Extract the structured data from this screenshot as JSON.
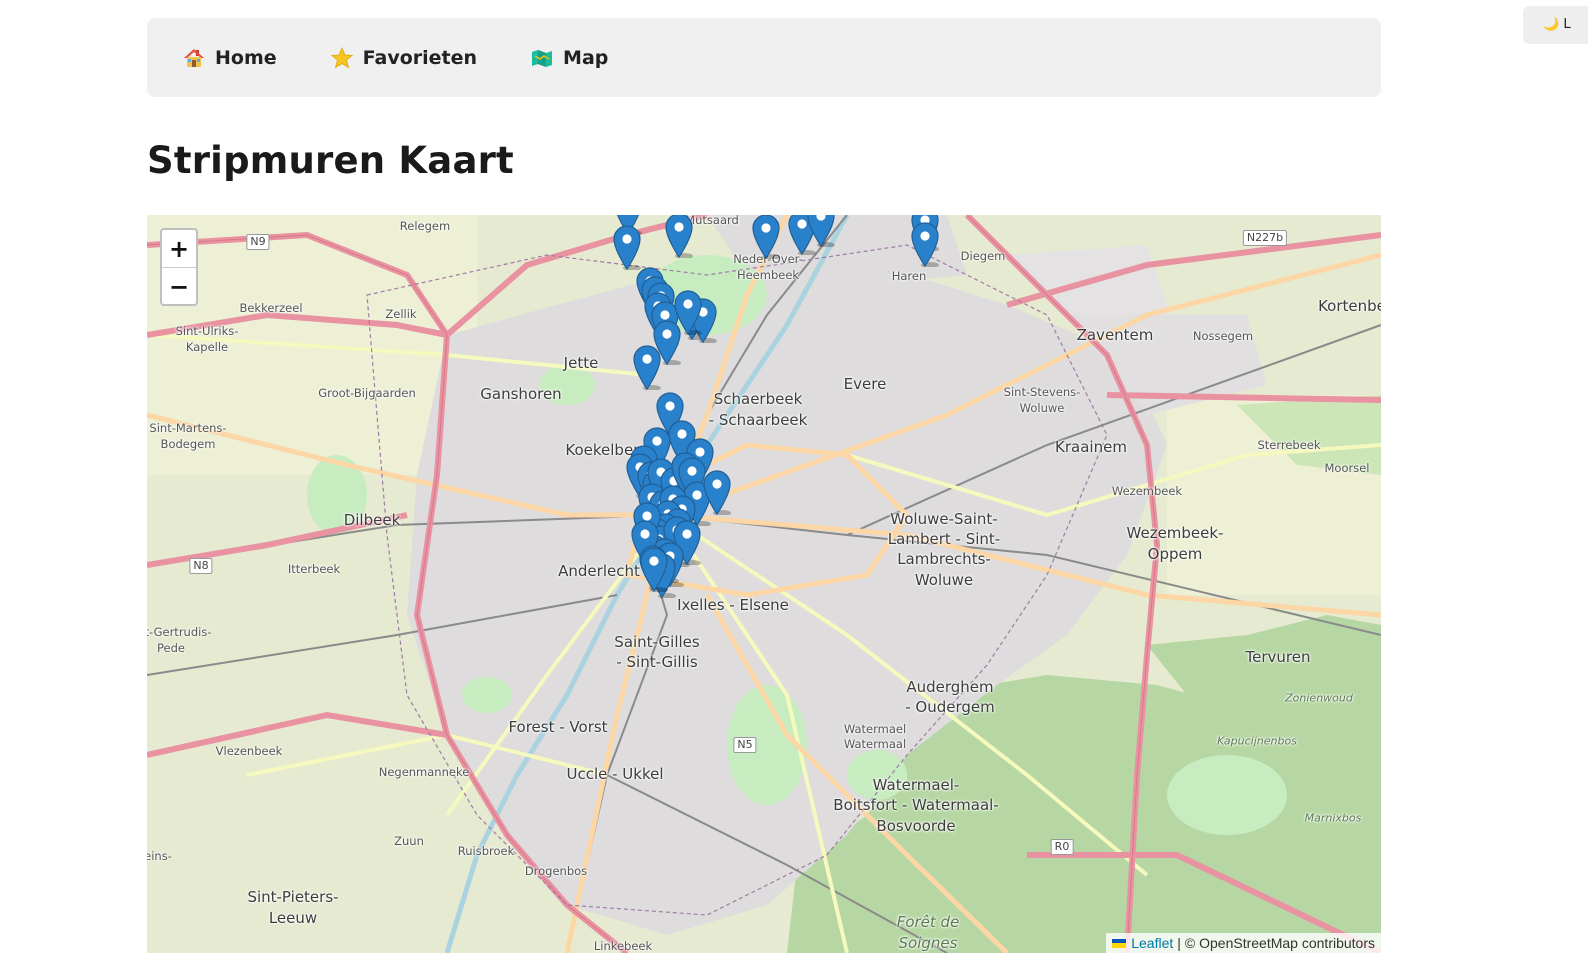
{
  "theme_toggle": {
    "icon": "moon-icon",
    "glyph": "🌙",
    "label": "L"
  },
  "nav": {
    "items": [
      {
        "id": "home",
        "label": "Home",
        "icon": "house-icon"
      },
      {
        "id": "favorieten",
        "label": "Favorieten",
        "icon": "star-icon"
      },
      {
        "id": "map",
        "label": "Map",
        "icon": "map-icon"
      }
    ]
  },
  "page": {
    "title": "Stripmuren Kaart"
  },
  "map": {
    "zoom_in_label": "+",
    "zoom_out_label": "−",
    "attribution": {
      "leaflet_label": "Leaflet",
      "separator": "|",
      "copyright": "© OpenStreetMap contributors"
    },
    "labels": {
      "relegem": "Relegem",
      "mutsaard": "Mutsaard",
      "neder_over": "Neder-Over-",
      "heembeek": "Heembeek",
      "haren": "Haren",
      "diegem": "Diegem",
      "bekkerzeel": "Bekkerzeel",
      "zellik": "Zellik",
      "sint_ulriks": "Sint-Ulriks-",
      "kapelle": "Kapelle",
      "zaventem": "Zaventem",
      "nossegem": "Nossegem",
      "kortenberg": "Kortenbe",
      "jette": "Jette",
      "groot_bijgaarden": "Groot-Bijgaarden",
      "ganshoren": "Ganshoren",
      "evere": "Evere",
      "schaerbeek": "Schaerbeek",
      "schaarbeek": "- Schaarbeek",
      "sint_stevens": "Sint-Stevens-",
      "woluwe1": "Woluwe",
      "sint_martens": "Sint-Martens-",
      "bodegem": "Bodegem",
      "koekelberg": "Koekelberg",
      "kraainem": "Kraainem",
      "sterrebeek": "Sterrebeek",
      "moorsel": "Moorsel",
      "wezembeek": "Wezembeek",
      "dilbeek": "Dilbeek",
      "wolsl1": "Woluwe-Saint-",
      "wolsl2": "Lambert - Sint-",
      "wolsl3": "Lambrechts-",
      "wolsl4": "Woluwe",
      "wezoppem1": "Wezembeek-",
      "wezoppem2": "Oppem",
      "itterbeek": "Itterbeek",
      "anderlecht": "Anderlecht",
      "ixelles": "Ixelles - Elsene",
      "sint_gertrudis": "t-Gertrudis-",
      "pede": "Pede",
      "saint_gilles": "Saint-Gilles",
      "sint_gillis": "- Sint-Gillis",
      "tervuren": "Tervuren",
      "auderghem": "Auderghem",
      "oudergem": "- Oudergem",
      "zonienwoud": "Zonienwoud",
      "forest": "Forest - Vorst",
      "watermael_s1": "Watermael",
      "watermael_s2": "Watermaal",
      "kapucijnenbos": "Kapucijnenbos",
      "vlezenbeek": "Vlezenbeek",
      "negenmanneke": "Negenmanneke",
      "uccle": "Uccle - Ukkel",
      "wb1": "Watermael-",
      "wb2": "Boitsfort - Watermaal-",
      "wb3": "Bosvoorde",
      "marnixbos": "Marnixbos",
      "zuun": "Zuun",
      "ruisbroek": "Ruisbroek",
      "eins": "eins-",
      "drogenbos": "Drogenbos",
      "sint_pieters": "Sint-Pieters-",
      "leeuw": "Leeuw",
      "foret": "Forêt de",
      "soignes": "Soignes",
      "linkebeek": "Linkebeek"
    },
    "roads": {
      "n9": "N9",
      "n227b": "N227b",
      "n8": "N8",
      "n5": "N5",
      "r0": "R0"
    },
    "marker_count": 52
  },
  "colors": {
    "marker": "#2a81cb",
    "marker_dark": "#1f5f96",
    "motorway": "#e892a2",
    "primary": "#fcd6a4",
    "secondary": "#f7fabf",
    "forest": "#add19e",
    "park": "#c8facc",
    "urban": "#e0dfdf"
  }
}
